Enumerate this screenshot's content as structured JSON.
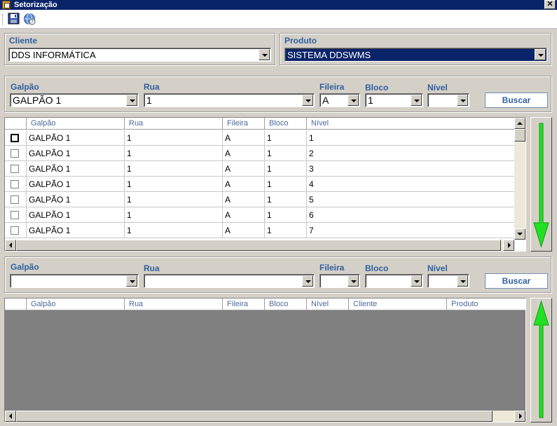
{
  "window": {
    "title": "Setorização",
    "close_glyph": "✕"
  },
  "toolbar": {
    "save_icon": "floppy-save-icon",
    "help_icon": "help-globe-icon"
  },
  "cliente": {
    "label": "Cliente",
    "value": "DDS INFORMÁTICA"
  },
  "produto": {
    "label": "Produto",
    "value": "SISTEMA DDSWMS"
  },
  "filter_top": {
    "galpao_label": "Galpão",
    "galpao_value": "GALPÃO 1",
    "rua_label": "Rua",
    "rua_value": "1",
    "fileira_label": "Fileira",
    "fileira_value": "A",
    "bloco_label": "Bloco",
    "bloco_value": "1",
    "nivel_label": "Nível",
    "nivel_value": "",
    "buscar_label": "Buscar"
  },
  "grid_top": {
    "columns": [
      "Galpão",
      "Rua",
      "Fileira",
      "Bloco",
      "Nível"
    ],
    "rows": [
      [
        "GALPÃO 1",
        "1",
        "A",
        "1",
        "1"
      ],
      [
        "GALPÃO 1",
        "1",
        "A",
        "1",
        "2"
      ],
      [
        "GALPÃO 1",
        "1",
        "A",
        "1",
        "3"
      ],
      [
        "GALPÃO 1",
        "1",
        "A",
        "1",
        "4"
      ],
      [
        "GALPÃO 1",
        "1",
        "A",
        "1",
        "5"
      ],
      [
        "GALPÃO 1",
        "1",
        "A",
        "1",
        "6"
      ],
      [
        "GALPÃO 1",
        "1",
        "A",
        "1",
        "7"
      ]
    ]
  },
  "filter_bottom": {
    "galpao_label": "Galpão",
    "galpao_value": "",
    "rua_label": "Rua",
    "rua_value": "",
    "fileira_label": "Fileira",
    "fileira_value": "",
    "bloco_label": "Bloco",
    "bloco_value": "",
    "nivel_label": "Nível",
    "nivel_value": "",
    "buscar_label": "Buscar"
  },
  "grid_bottom": {
    "columns": [
      "Galpão",
      "Rua",
      "Fileira",
      "Bloco",
      "Nível",
      "Cliente",
      "Produto"
    ]
  },
  "colors": {
    "title_bar": "#0a246a",
    "label_blue": "#2f5f9f",
    "arrow_green": "#22e022",
    "selection": "#0a246a"
  },
  "move_down_icon": "green-down-arrow-icon",
  "move_up_icon": "green-up-arrow-icon"
}
